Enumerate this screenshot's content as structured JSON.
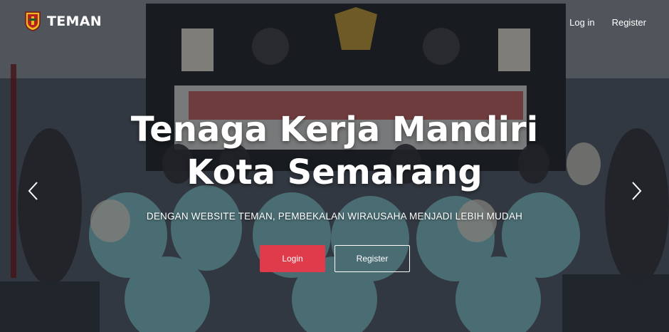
{
  "brand": {
    "name": "TEMAN",
    "logo_icon": "city-emblem-icon"
  },
  "nav": {
    "login": "Log in",
    "register": "Register"
  },
  "hero": {
    "title_line1": "Tenaga Kerja Mandiri",
    "title_line2": "Kota Semarang",
    "subtitle": "DENGAN WEBSITE TEMAN, PEMBEKALAN WIRAUSAHA MENJADI LEBIH MUDAH",
    "login_button": "Login",
    "register_button": "Register"
  },
  "carousel": {
    "prev_icon": "chevron-left-icon",
    "next_icon": "chevron-right-icon"
  },
  "colors": {
    "accent": "#e03b4b",
    "overlay": "#14181e"
  }
}
